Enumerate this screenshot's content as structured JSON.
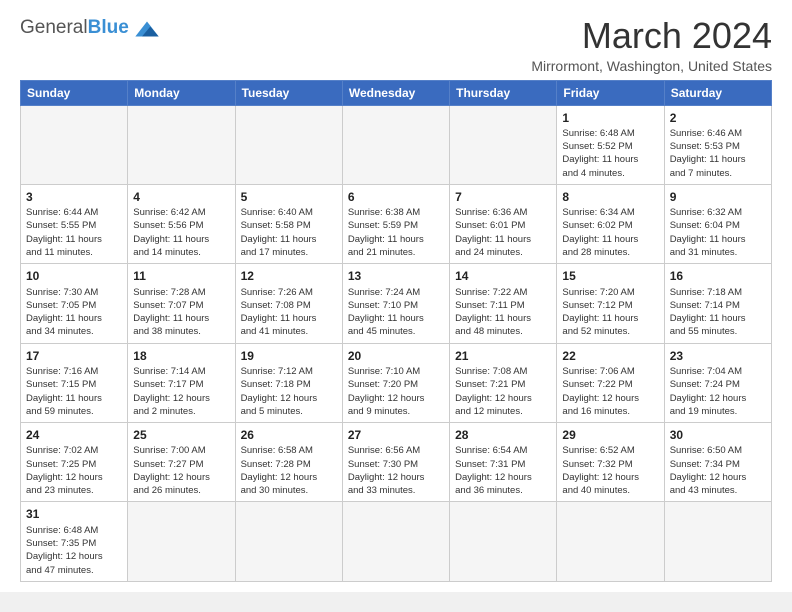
{
  "header": {
    "logo_general": "General",
    "logo_blue": "Blue",
    "title": "March 2024",
    "location": "Mirrormont, Washington, United States"
  },
  "days_of_week": [
    "Sunday",
    "Monday",
    "Tuesday",
    "Wednesday",
    "Thursday",
    "Friday",
    "Saturday"
  ],
  "weeks": [
    [
      {
        "day": "",
        "info": "",
        "empty": true
      },
      {
        "day": "",
        "info": "",
        "empty": true
      },
      {
        "day": "",
        "info": "",
        "empty": true
      },
      {
        "day": "",
        "info": "",
        "empty": true
      },
      {
        "day": "",
        "info": "",
        "empty": true
      },
      {
        "day": "1",
        "info": "Sunrise: 6:48 AM\nSunset: 5:52 PM\nDaylight: 11 hours\nand 4 minutes."
      },
      {
        "day": "2",
        "info": "Sunrise: 6:46 AM\nSunset: 5:53 PM\nDaylight: 11 hours\nand 7 minutes."
      }
    ],
    [
      {
        "day": "3",
        "info": "Sunrise: 6:44 AM\nSunset: 5:55 PM\nDaylight: 11 hours\nand 11 minutes."
      },
      {
        "day": "4",
        "info": "Sunrise: 6:42 AM\nSunset: 5:56 PM\nDaylight: 11 hours\nand 14 minutes."
      },
      {
        "day": "5",
        "info": "Sunrise: 6:40 AM\nSunset: 5:58 PM\nDaylight: 11 hours\nand 17 minutes."
      },
      {
        "day": "6",
        "info": "Sunrise: 6:38 AM\nSunset: 5:59 PM\nDaylight: 11 hours\nand 21 minutes."
      },
      {
        "day": "7",
        "info": "Sunrise: 6:36 AM\nSunset: 6:01 PM\nDaylight: 11 hours\nand 24 minutes."
      },
      {
        "day": "8",
        "info": "Sunrise: 6:34 AM\nSunset: 6:02 PM\nDaylight: 11 hours\nand 28 minutes."
      },
      {
        "day": "9",
        "info": "Sunrise: 6:32 AM\nSunset: 6:04 PM\nDaylight: 11 hours\nand 31 minutes."
      }
    ],
    [
      {
        "day": "10",
        "info": "Sunrise: 7:30 AM\nSunset: 7:05 PM\nDaylight: 11 hours\nand 34 minutes."
      },
      {
        "day": "11",
        "info": "Sunrise: 7:28 AM\nSunset: 7:07 PM\nDaylight: 11 hours\nand 38 minutes."
      },
      {
        "day": "12",
        "info": "Sunrise: 7:26 AM\nSunset: 7:08 PM\nDaylight: 11 hours\nand 41 minutes."
      },
      {
        "day": "13",
        "info": "Sunrise: 7:24 AM\nSunset: 7:10 PM\nDaylight: 11 hours\nand 45 minutes."
      },
      {
        "day": "14",
        "info": "Sunrise: 7:22 AM\nSunset: 7:11 PM\nDaylight: 11 hours\nand 48 minutes."
      },
      {
        "day": "15",
        "info": "Sunrise: 7:20 AM\nSunset: 7:12 PM\nDaylight: 11 hours\nand 52 minutes."
      },
      {
        "day": "16",
        "info": "Sunrise: 7:18 AM\nSunset: 7:14 PM\nDaylight: 11 hours\nand 55 minutes."
      }
    ],
    [
      {
        "day": "17",
        "info": "Sunrise: 7:16 AM\nSunset: 7:15 PM\nDaylight: 11 hours\nand 59 minutes."
      },
      {
        "day": "18",
        "info": "Sunrise: 7:14 AM\nSunset: 7:17 PM\nDaylight: 12 hours\nand 2 minutes."
      },
      {
        "day": "19",
        "info": "Sunrise: 7:12 AM\nSunset: 7:18 PM\nDaylight: 12 hours\nand 5 minutes."
      },
      {
        "day": "20",
        "info": "Sunrise: 7:10 AM\nSunset: 7:20 PM\nDaylight: 12 hours\nand 9 minutes."
      },
      {
        "day": "21",
        "info": "Sunrise: 7:08 AM\nSunset: 7:21 PM\nDaylight: 12 hours\nand 12 minutes."
      },
      {
        "day": "22",
        "info": "Sunrise: 7:06 AM\nSunset: 7:22 PM\nDaylight: 12 hours\nand 16 minutes."
      },
      {
        "day": "23",
        "info": "Sunrise: 7:04 AM\nSunset: 7:24 PM\nDaylight: 12 hours\nand 19 minutes."
      }
    ],
    [
      {
        "day": "24",
        "info": "Sunrise: 7:02 AM\nSunset: 7:25 PM\nDaylight: 12 hours\nand 23 minutes."
      },
      {
        "day": "25",
        "info": "Sunrise: 7:00 AM\nSunset: 7:27 PM\nDaylight: 12 hours\nand 26 minutes."
      },
      {
        "day": "26",
        "info": "Sunrise: 6:58 AM\nSunset: 7:28 PM\nDaylight: 12 hours\nand 30 minutes."
      },
      {
        "day": "27",
        "info": "Sunrise: 6:56 AM\nSunset: 7:30 PM\nDaylight: 12 hours\nand 33 minutes."
      },
      {
        "day": "28",
        "info": "Sunrise: 6:54 AM\nSunset: 7:31 PM\nDaylight: 12 hours\nand 36 minutes."
      },
      {
        "day": "29",
        "info": "Sunrise: 6:52 AM\nSunset: 7:32 PM\nDaylight: 12 hours\nand 40 minutes."
      },
      {
        "day": "30",
        "info": "Sunrise: 6:50 AM\nSunset: 7:34 PM\nDaylight: 12 hours\nand 43 minutes."
      }
    ],
    [
      {
        "day": "31",
        "info": "Sunrise: 6:48 AM\nSunset: 7:35 PM\nDaylight: 12 hours\nand 47 minutes."
      },
      {
        "day": "",
        "info": "",
        "empty": true
      },
      {
        "day": "",
        "info": "",
        "empty": true
      },
      {
        "day": "",
        "info": "",
        "empty": true
      },
      {
        "day": "",
        "info": "",
        "empty": true
      },
      {
        "day": "",
        "info": "",
        "empty": true
      },
      {
        "day": "",
        "info": "",
        "empty": true
      }
    ]
  ]
}
